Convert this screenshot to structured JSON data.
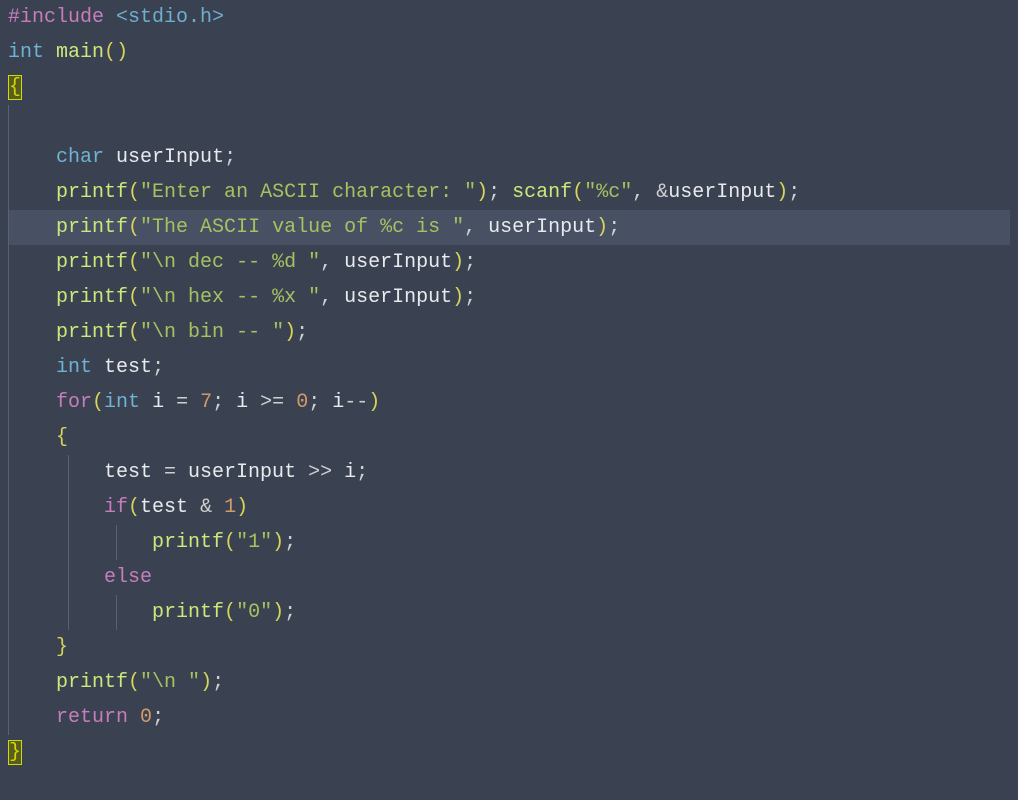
{
  "code": {
    "l1": {
      "t1": "#include",
      "t2": " ",
      "t3": "<stdio.h>"
    },
    "l2": {
      "t1": "int",
      "t2": " ",
      "t3": "main",
      "t4": "(",
      "t5": ")"
    },
    "l3": {
      "brace": "{"
    },
    "l4": "",
    "l5": {
      "ind": "    ",
      "t1": "char",
      "t2": " ",
      "t3": "userInput",
      "t4": ";"
    },
    "l6": {
      "ind": "    ",
      "t1": "printf",
      "t2": "(",
      "t3": "\"Enter an ASCII character: \"",
      "t4": ")",
      "t5": ";",
      "t6": " ",
      "t7": "scanf",
      "t8": "(",
      "t9": "\"%c\"",
      "t10": ",",
      "t11": " ",
      "t12": "&",
      "t13": "userInput",
      "t14": ")",
      "t15": ";"
    },
    "l7": {
      "ind": "    ",
      "t1": "printf",
      "t2": "(",
      "t3": "\"The ASCII value of %c is \"",
      "t4": ",",
      "t5": " ",
      "t6": "userInput",
      "t7": ")",
      "t8": ";"
    },
    "l8": {
      "ind": "    ",
      "t1": "printf",
      "t2": "(",
      "t3": "\"\\n dec -- %d \"",
      "t4": ",",
      "t5": " ",
      "t6": "userInput",
      "t7": ")",
      "t8": ";"
    },
    "l9": {
      "ind": "    ",
      "t1": "printf",
      "t2": "(",
      "t3": "\"\\n hex -- %x \"",
      "t4": ",",
      "t5": " ",
      "t6": "userInput",
      "t7": ")",
      "t8": ";"
    },
    "l10": {
      "ind": "    ",
      "t1": "printf",
      "t2": "(",
      "t3": "\"\\n bin -- \"",
      "t4": ")",
      "t5": ";"
    },
    "l11": {
      "ind": "    ",
      "t1": "int",
      "t2": " ",
      "t3": "test",
      "t4": ";"
    },
    "l12": {
      "ind": "    ",
      "t1": "for",
      "t2": "(",
      "t3": "int",
      "t4": " ",
      "t5": "i",
      "t6": " = ",
      "t7": "7",
      "t8": ";",
      "t9": " ",
      "t10": "i",
      "t11": " >= ",
      "t12": "0",
      "t13": ";",
      "t14": " ",
      "t15": "i",
      "t16": "--",
      "t17": ")"
    },
    "l13": {
      "ind": "    ",
      "t1": "{"
    },
    "l14": {
      "ind": "        ",
      "t1": "test",
      "t2": " = ",
      "t3": "userInput",
      "t4": " >> ",
      "t5": "i",
      "t6": ";"
    },
    "l15": {
      "ind": "        ",
      "t1": "if",
      "t2": "(",
      "t3": "test",
      "t4": " & ",
      "t5": "1",
      "t6": ")"
    },
    "l16": {
      "ind": "            ",
      "t1": "printf",
      "t2": "(",
      "t3": "\"1\"",
      "t4": ")",
      "t5": ";"
    },
    "l17": {
      "ind": "        ",
      "t1": "else"
    },
    "l18": {
      "ind": "            ",
      "t1": "printf",
      "t2": "(",
      "t3": "\"0\"",
      "t4": ")",
      "t5": ";"
    },
    "l19": {
      "ind": "    ",
      "t1": "}"
    },
    "l20": {
      "ind": "    ",
      "t1": "printf",
      "t2": "(",
      "t3": "\"\\n \"",
      "t4": ")",
      "t5": ";"
    },
    "l21": {
      "ind": "    ",
      "t1": "return",
      "t2": " ",
      "t3": "0",
      "t4": ";"
    },
    "l22": {
      "brace": "}"
    }
  }
}
